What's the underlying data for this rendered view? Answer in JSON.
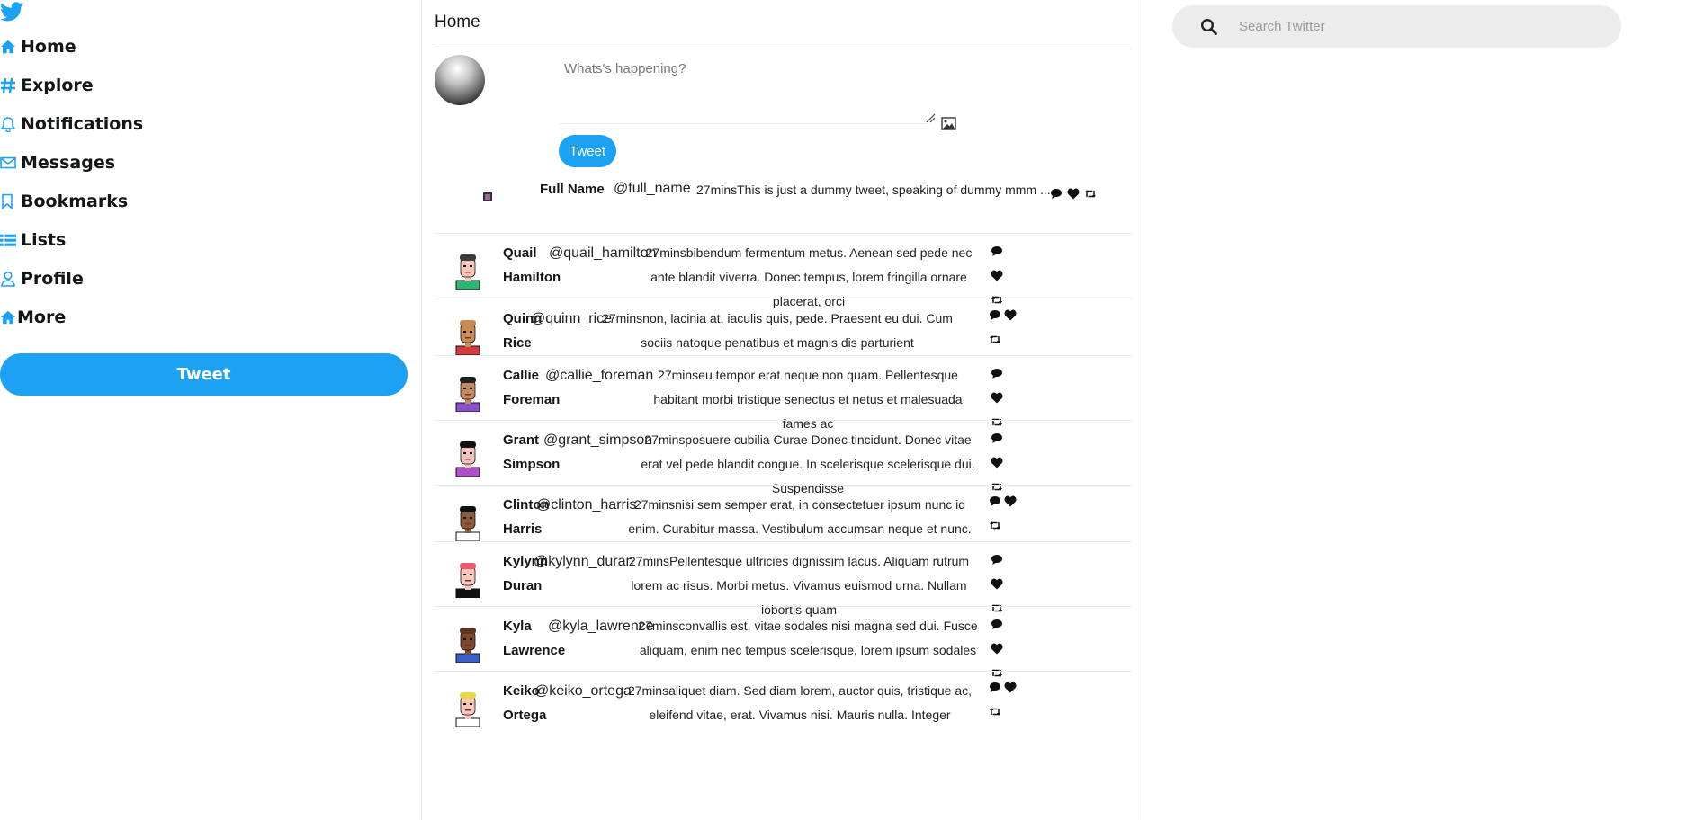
{
  "sidebar": {
    "logo_icon": "twitter-bird-icon",
    "accent": "#1da1f2",
    "items": [
      {
        "label": "Home",
        "icon": "home-icon"
      },
      {
        "label": "Explore",
        "icon": "hashtag-icon"
      },
      {
        "label": "Notifications",
        "icon": "bell-icon"
      },
      {
        "label": "Messages",
        "icon": "envelope-icon"
      },
      {
        "label": "Bookmarks",
        "icon": "bookmark-icon"
      },
      {
        "label": "Lists",
        "icon": "list-icon"
      },
      {
        "label": "Profile",
        "icon": "user-icon"
      },
      {
        "label": "More",
        "icon": "home-icon"
      }
    ],
    "tweet_button": "Tweet"
  },
  "feed": {
    "title": "Home",
    "compose": {
      "placeholder": "Whats's happening?",
      "tweet_button": "Tweet"
    },
    "first_tweet": {
      "name": "Full Name",
      "handle": "@full_name",
      "text": "27minsThis is just a dummy tweet, speaking of dummy mmm ..."
    },
    "tweets": [
      {
        "first": "Quail",
        "last": "Hamilton",
        "handle": "@quail_hamilton",
        "text": "27minsbibendum fermentum metus. Aenean sed pede nec ante blandit viverra. Donec tempus, lorem fringilla ornare placerat, orci",
        "avatar_shirt": "#2bb673",
        "avatar_skin": "#f4c7b8",
        "avatar_hair": "#3a3a3a"
      },
      {
        "first": "Quinn",
        "last": "Rice",
        "handle": "@quinn_rice",
        "text": "27minsnon, lacinia at, iaculis quis, pede. Praesent eu dui. Cum sociis natoque penatibus et magnis dis parturient",
        "avatar_shirt": "#d63b3b",
        "avatar_skin": "#c98b55",
        "avatar_hair": "#c98b55"
      },
      {
        "first": "Callie",
        "last": "Foreman",
        "handle": "@callie_foreman",
        "text": "27minseu tempor erat neque non quam. Pellentesque habitant morbi tristique senectus et netus et malesuada fames ac",
        "avatar_shirt": "#8a4fd1",
        "avatar_skin": "#c08a5c",
        "avatar_hair": "#222222"
      },
      {
        "first": "Grant",
        "last": "Simpson",
        "handle": "@grant_simpson",
        "text": "27minsposuere cubilia Curae Donec tincidunt. Donec vitae erat vel pede blandit congue. In scelerisque scelerisque dui. Suspendisse",
        "avatar_shirt": "#b04fc9",
        "avatar_skin": "#f2c2c2",
        "avatar_hair": "#111111"
      },
      {
        "first": "Clinton",
        "last": "Harris",
        "handle": "@clinton_harris",
        "text": "27minsnisi sem semper erat, in consectetuer ipsum nunc id enim. Curabitur massa. Vestibulum accumsan neque et nunc.",
        "avatar_shirt": "#ffffff",
        "avatar_skin": "#8a5a3c",
        "avatar_hair": "#111111"
      },
      {
        "first": "Kylynn",
        "last": "Duran",
        "handle": "@kylynn_duran",
        "text": "27minsPellentesque ultricies dignissim lacus. Aliquam rutrum lorem ac risus. Morbi metus. Vivamus euismod urna. Nullam lobortis quam",
        "avatar_shirt": "#111111",
        "avatar_skin": "#f4c7b8",
        "avatar_hair": "#ef5b6e"
      },
      {
        "first": "Kyla",
        "last": "Lawrence",
        "handle": "@kyla_lawrence",
        "text": "27minsconvallis est, vitae sodales nisi magna sed dui. Fusce aliquam, enim nec tempus scelerisque, lorem ipsum sodales",
        "avatar_shirt": "#3a5fc9",
        "avatar_skin": "#7a4a2e",
        "avatar_hair": "#5a3520"
      },
      {
        "first": "Keiko",
        "last": "Ortega",
        "handle": "@keiko_ortega",
        "text": "27minsaliquet diam. Sed diam lorem, auctor quis, tristique ac, eleifend vitae, erat. Vivamus nisi. Mauris nulla. Integer",
        "avatar_shirt": "#ffffff",
        "avatar_skin": "#f4c7b8",
        "avatar_hair": "#e8d84a"
      }
    ]
  },
  "search": {
    "placeholder": "Search Twitter",
    "icon": "search-icon"
  }
}
